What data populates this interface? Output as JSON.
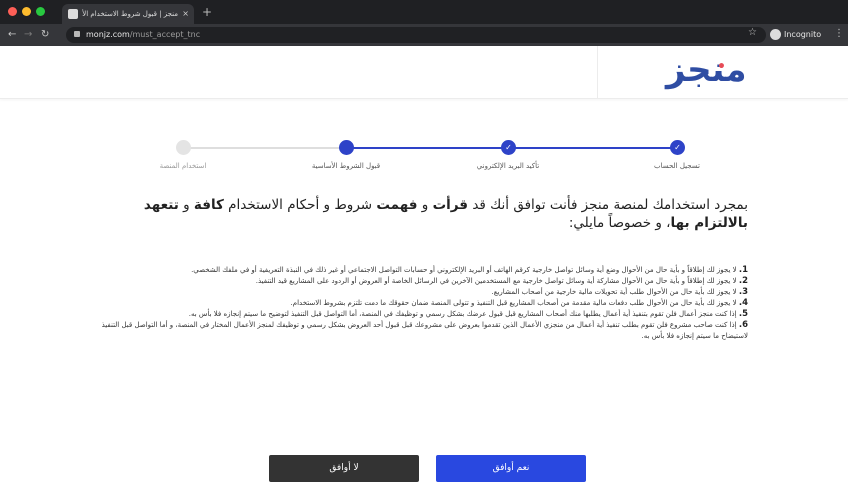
{
  "browser": {
    "tab_title": "منجز | قبول شروط الاستخدام الأسا…",
    "tab_close": "×",
    "new_tab": "+",
    "url_domain": "monjz.com",
    "url_path": "/must_accept_tnc",
    "mode_label": "Incognito"
  },
  "site": {
    "logo_text": "منجز",
    "colors": {
      "brand": "#2f4da3",
      "accent": "#e74c57",
      "step_active": "#2e43c8",
      "button_primary": "#2948e0",
      "button_dark": "#333333"
    }
  },
  "stepper": {
    "steps": [
      {
        "label": "تسجيل الحساب",
        "state": "done",
        "mark": "✓"
      },
      {
        "label": "تأكيد البريد الإلكتروني",
        "state": "done",
        "mark": "✓"
      },
      {
        "label": "قبول الشروط الأساسية",
        "state": "current",
        "mark": ""
      },
      {
        "label": "استخدام المنصة",
        "state": "pending",
        "mark": ""
      }
    ]
  },
  "content": {
    "intro_1": "بمجرد استخدامك لمنصة منجز فأنت توافق أنك قد ",
    "intro_read": "قرأت",
    "intro_2": " و ",
    "intro_understood": "فهمت",
    "intro_3": " شروط و أحكام الاستخدام ",
    "intro_all": "كافة",
    "intro_4": " و ",
    "intro_commit": "تتعهد بالالتزام بها",
    "intro_5": "، و خصوصاً مايلي:",
    "terms": [
      {
        "num": "1.",
        "text": "لا يجوز لك إطلاقاً و بأية حال من الأحوال وضع أية وسائل تواصل خارجية كرقم الهاتف أو البريد الإلكتروني أو حسابات التواصل الاجتماعي أو غير ذلك في النبذة التعريفية أو في ملفك الشخصي."
      },
      {
        "num": "2.",
        "text": "لا يجوز لك إطلاقاً و بأية حال من الأحوال مشاركة أية وسائل تواصل خارجية مع المستخدمين الآخرين في الرسائل الخاصة أو العروض أو الردود على المشاريع قيد التنفيذ."
      },
      {
        "num": "3.",
        "text": "لا يجوز لك بأية حال من الأحوال طلب أية تحويلات مالية خارجية من أصحاب المشاريع."
      },
      {
        "num": "4.",
        "text": "لا يجوز لك بأية حال من الأحوال طلب دفعات مالية مقدمة من أصحاب المشاريع قبل التنفيذ و تتولى المنصة ضمان حقوقك ما دمت تلتزم بشروط الاستخدام."
      },
      {
        "num": "5.",
        "text": "إذا كنت منجز أعمال فلن تقوم بتنفيذ أية أعمال يطلبها منك أصحاب المشاريع قبل قبول عرضك بشكل رسمي و توظيفك في المنصة، أما التواصل قبل التنفيذ لتوضيح ما سيتم إنجازه فلا بأس به."
      },
      {
        "num": "6.",
        "text": "إذا كنت صاحب مشروع فلن تقوم بطلب تنفيذ أية أعمال من منجزي الأعمال الذين تقدموا بعروض على مشروعك قبل قبول أحد العروض بشكل رسمي و توظيفك لمنجز الأعمال المختار في المنصة، و أما التواصل قبل التنفيذ لاستيضاح ما سيتم إنجازه فلا بأس به."
      }
    ]
  },
  "actions": {
    "decline_label": "لا أوافق",
    "accept_label": "نعم أوافق"
  }
}
